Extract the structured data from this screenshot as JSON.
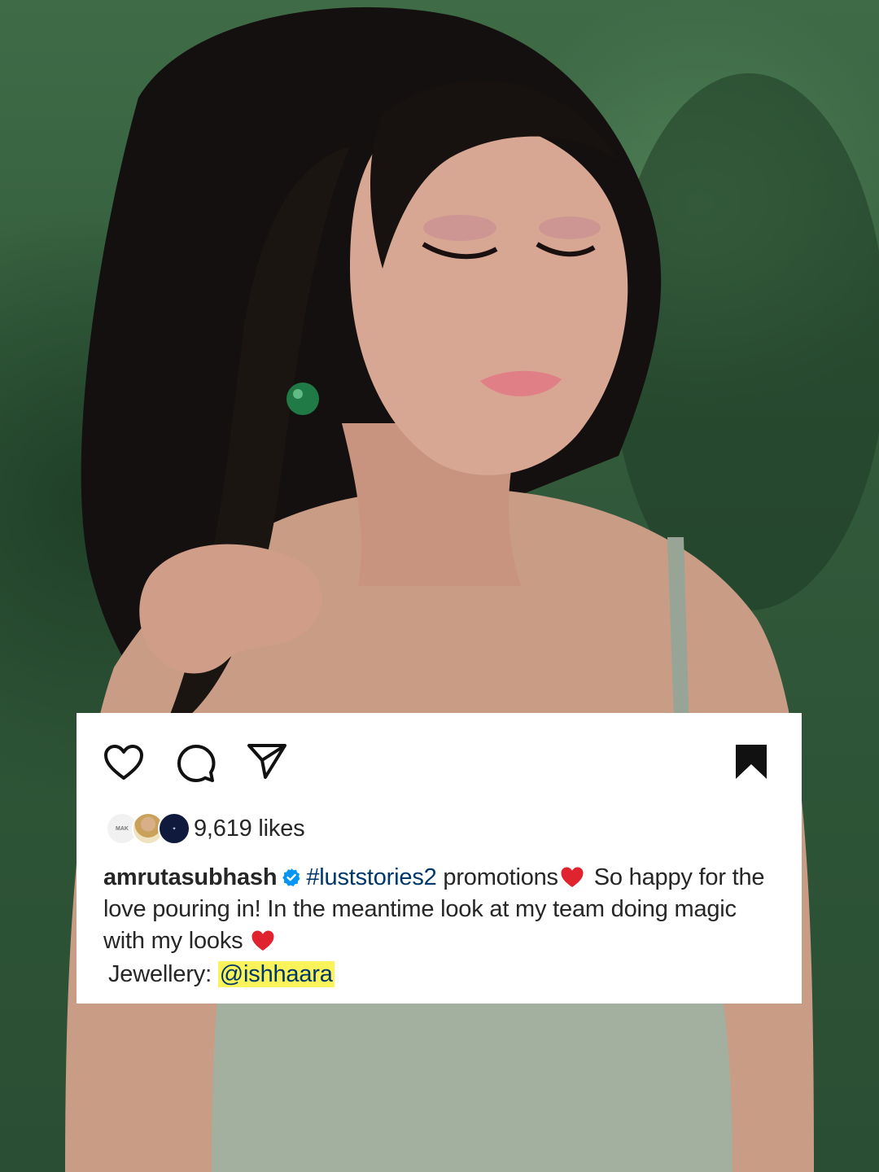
{
  "post": {
    "likes": "9,619 likes",
    "username": "amrutasubhash",
    "hashtag": "#luststories2",
    "caption_after_hashtag": " promotions",
    "caption_rest": " So happy for the love pouring in! In the meantime look at my team doing magic with my looks ",
    "jewellery_label": "Jewellery: ",
    "jewellery_mention": "@ishhaara"
  },
  "icons": {
    "like": "heart-outline-icon",
    "comment": "comment-bubble-icon",
    "share": "paper-plane-icon",
    "save": "bookmark-filled-icon",
    "verified": "verified-badge-icon",
    "emoji": "red-heart-emoji"
  },
  "colors": {
    "background_green": "#3f6c47",
    "text": "#262626",
    "link": "#00376b",
    "verified_blue": "#0095f6",
    "mention_highlight": "#fbf35a",
    "heart_red": "#e0242f"
  }
}
